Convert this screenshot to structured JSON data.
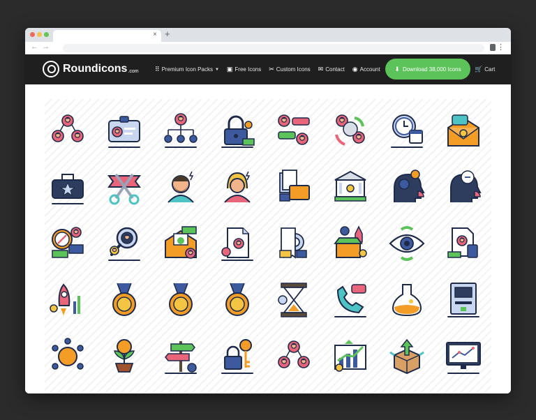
{
  "browser": {
    "tab_close": "×",
    "new_tab": "+",
    "back": "←",
    "forward": "→",
    "menu": "⋮"
  },
  "site": {
    "logo_text": "Roundicons",
    "logo_suffix": ".com",
    "nav": [
      {
        "label": "Premium Icon Packs",
        "icon": "grid-icon",
        "glyph": "⠿",
        "dropdown": true
      },
      {
        "label": "Free Icons",
        "icon": "gift-icon",
        "glyph": "▣"
      },
      {
        "label": "Custom Icons",
        "icon": "tools-icon",
        "glyph": "✂"
      },
      {
        "label": "Contact",
        "icon": "envelope-icon",
        "glyph": "✉"
      },
      {
        "label": "Account",
        "icon": "user-circle-icon",
        "glyph": "◉"
      }
    ],
    "download_button": "Download 38,000 Icons",
    "download_glyph": "⬇",
    "cart": "Cart",
    "cart_glyph": "🛒",
    "caret": "▼"
  },
  "icons": [
    {
      "name": "team-network-icon",
      "type": "team"
    },
    {
      "name": "id-card-icon",
      "type": "idcard"
    },
    {
      "name": "org-chart-icon",
      "type": "org"
    },
    {
      "name": "padlock-coins-icon",
      "type": "lock"
    },
    {
      "name": "chat-people-icon",
      "type": "chat"
    },
    {
      "name": "team-cycle-icon",
      "type": "cycle"
    },
    {
      "name": "clock-calendar-icon",
      "type": "clock"
    },
    {
      "name": "envelope-letter-icon",
      "type": "mail"
    },
    {
      "name": "briefcase-star-icon",
      "type": "bag"
    },
    {
      "name": "ribbon-scissors-icon",
      "type": "scissors"
    },
    {
      "name": "bearded-man-icon",
      "type": "man"
    },
    {
      "name": "woman-avatar-icon",
      "type": "woman"
    },
    {
      "name": "documents-briefcase-icon",
      "type": "docs"
    },
    {
      "name": "bank-building-icon",
      "type": "bank"
    },
    {
      "name": "head-gear-icon",
      "type": "headgear"
    },
    {
      "name": "head-cloud-icon",
      "type": "headcloud"
    },
    {
      "name": "compass-money-icon",
      "type": "compass"
    },
    {
      "name": "magnifier-person-icon",
      "type": "magnifier"
    },
    {
      "name": "envelope-check-icon",
      "type": "mailcheck"
    },
    {
      "name": "document-location-icon",
      "type": "doc"
    },
    {
      "name": "receipt-magnet-icon",
      "type": "receipt"
    },
    {
      "name": "shop-rocket-icon",
      "type": "shop"
    },
    {
      "name": "eye-recycle-icon",
      "type": "eye"
    },
    {
      "name": "document-calculator-icon",
      "type": "doccalc"
    },
    {
      "name": "rocket-growth-icon",
      "type": "rocket"
    },
    {
      "name": "star-medal-icon",
      "type": "medal"
    },
    {
      "name": "number-one-medal-icon",
      "type": "medal"
    },
    {
      "name": "dollar-medal-icon",
      "type": "medal"
    },
    {
      "name": "hourglass-icon",
      "type": "hourglass"
    },
    {
      "name": "phone-chat-icon",
      "type": "phone"
    },
    {
      "name": "flask-icon",
      "type": "flask"
    },
    {
      "name": "atm-machine-icon",
      "type": "atm"
    },
    {
      "name": "dollar-network-icon",
      "type": "dollarnet"
    },
    {
      "name": "money-plant-icon",
      "type": "plant"
    },
    {
      "name": "signpost-icon",
      "type": "sign"
    },
    {
      "name": "lock-key-icon",
      "type": "lockkey"
    },
    {
      "name": "people-circle-icon",
      "type": "team"
    },
    {
      "name": "growth-chart-icon",
      "type": "chart"
    },
    {
      "name": "open-box-icon",
      "type": "box"
    },
    {
      "name": "monitor-graph-icon",
      "type": "monitor"
    }
  ],
  "palette": {
    "outline": "#1e2a4a",
    "blue": "#3e5a9e",
    "pink": "#e8657a",
    "orange": "#f39c26",
    "green": "#5cc35a",
    "yellow": "#f4c542",
    "teal": "#4ec3c3",
    "light": "#c8d6ef"
  }
}
